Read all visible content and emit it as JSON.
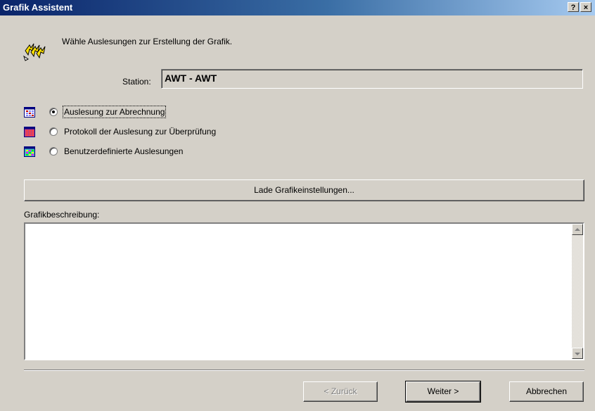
{
  "window": {
    "title": "Grafik Assistent",
    "help_label": "?",
    "close_label": "×"
  },
  "instruction": "Wähle Auslesungen zur Erstellung der Grafik.",
  "station": {
    "label": "Station:",
    "value": "AWT - AWT"
  },
  "options": [
    {
      "label": "Auslesung zur Abrechnung",
      "selected": true,
      "icon": "calendar-icon"
    },
    {
      "label": "Protokoll der Auslesung zur Überprüfung",
      "selected": false,
      "icon": "calendar-icon"
    },
    {
      "label": "Benutzerdefinierte Auslesungen",
      "selected": false,
      "icon": "calendar-icon"
    }
  ],
  "load_button": {
    "label": "Lade Grafikeinstellungen..."
  },
  "description": {
    "label": "Grafikbeschreibung:",
    "value": ""
  },
  "buttons": {
    "back": "< Zurück",
    "next": "Weiter >",
    "cancel": "Abbrechen"
  }
}
